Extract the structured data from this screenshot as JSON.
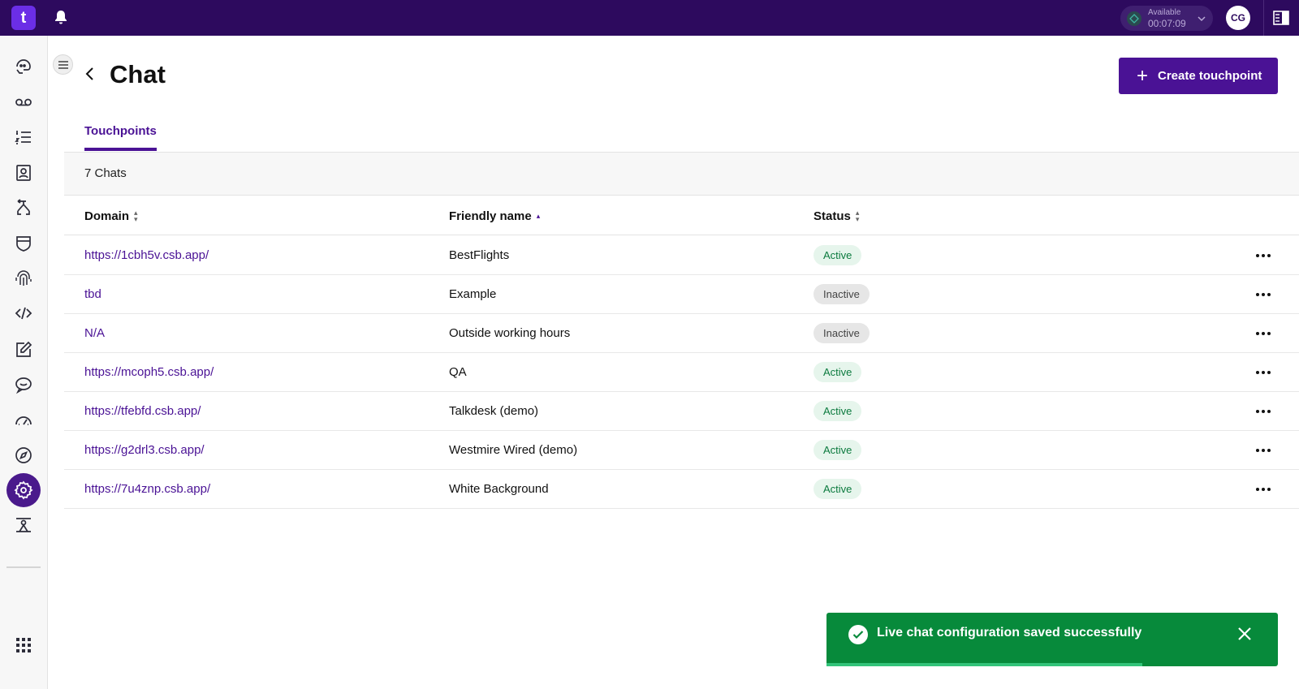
{
  "topbar": {
    "logo_text": "t",
    "status": {
      "label": "Available",
      "timer": "00:07:09"
    },
    "avatar_initials": "CG"
  },
  "sidebar": {
    "items": [
      {
        "icon": "conversations-icon"
      },
      {
        "icon": "voicemail-icon"
      },
      {
        "icon": "list-icon"
      },
      {
        "icon": "contacts-icon"
      },
      {
        "icon": "routing-icon"
      },
      {
        "icon": "shield-icon"
      },
      {
        "icon": "fingerprint-icon"
      },
      {
        "icon": "code-icon"
      },
      {
        "icon": "edit-icon"
      },
      {
        "icon": "chat-icon"
      },
      {
        "icon": "dashboard-icon"
      },
      {
        "icon": "compass-icon"
      },
      {
        "icon": "settings-icon",
        "active": true
      },
      {
        "icon": "network-icon"
      },
      {
        "icon": "apps-grid-icon"
      }
    ]
  },
  "page": {
    "title": "Chat",
    "create_button": "Create touchpoint",
    "tab": "Touchpoints",
    "count": "7 Chats"
  },
  "table": {
    "headers": {
      "domain": "Domain",
      "friendly_name": "Friendly name",
      "status": "Status"
    },
    "rows": [
      {
        "domain": "https://1cbh5v.csb.app/",
        "friendly_name": "BestFlights",
        "status": "Active"
      },
      {
        "domain": "tbd",
        "friendly_name": "Example",
        "status": "Inactive"
      },
      {
        "domain": "N/A",
        "friendly_name": "Outside working hours",
        "status": "Inactive"
      },
      {
        "domain": "https://mcoph5.csb.app/",
        "friendly_name": "QA",
        "status": "Active"
      },
      {
        "domain": "https://tfebfd.csb.app/",
        "friendly_name": "Talkdesk (demo)",
        "status": "Active"
      },
      {
        "domain": "https://g2drl3.csb.app/",
        "friendly_name": "Westmire Wired (demo)",
        "status": "Active"
      },
      {
        "domain": "https://7u4znp.csb.app/",
        "friendly_name": "White Background",
        "status": "Active"
      }
    ]
  },
  "toast": {
    "message": "Live chat configuration saved successfully",
    "progress": 0.7
  },
  "colors": {
    "brand": "#2d0a5e",
    "accent": "#4a1295",
    "success": "#078a3b"
  }
}
